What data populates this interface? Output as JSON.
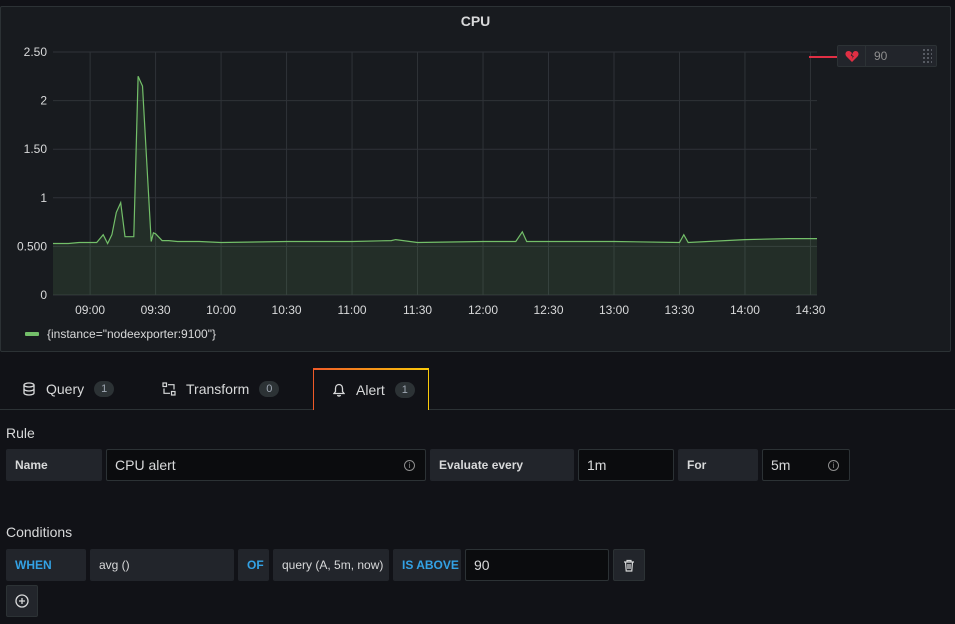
{
  "panel": {
    "title": "CPU",
    "threshold": {
      "value": "90",
      "icon": "heart-broken-icon",
      "color": "#e02f44"
    }
  },
  "chart_data": {
    "type": "area",
    "title": "CPU",
    "y_ticks": [
      "2.50",
      "2",
      "1.50",
      "1",
      "0.500",
      "0"
    ],
    "y_range": [
      0,
      2.5
    ],
    "x_ticks": [
      "09:00",
      "09:30",
      "10:00",
      "10:30",
      "11:00",
      "11:30",
      "12:00",
      "12:30",
      "13:00",
      "13:30",
      "14:00",
      "14:30"
    ],
    "grid": true,
    "legend_placement": "bottom-left",
    "series": [
      {
        "name": "{instance=\"nodeexporter:9100\"}",
        "color": "#73bf69",
        "x": [
          "08:43",
          "08:50",
          "08:55",
          "09:00",
          "09:03",
          "09:06",
          "09:08",
          "09:10",
          "09:12",
          "09:14",
          "09:16",
          "09:18",
          "09:20",
          "09:22",
          "09:23",
          "09:24",
          "09:28",
          "09:29",
          "09:30",
          "09:33",
          "09:36",
          "09:40",
          "09:50",
          "10:00",
          "10:30",
          "11:00",
          "11:18",
          "11:20",
          "11:30",
          "12:00",
          "12:15",
          "12:18",
          "12:20",
          "12:30",
          "13:00",
          "13:30",
          "13:32",
          "13:34",
          "14:00",
          "14:20",
          "14:30",
          "14:33"
        ],
        "values": [
          0.53,
          0.53,
          0.54,
          0.54,
          0.54,
          0.62,
          0.53,
          0.62,
          0.85,
          0.95,
          0.6,
          0.6,
          0.6,
          2.25,
          2.2,
          2.15,
          0.55,
          0.64,
          0.63,
          0.56,
          0.56,
          0.55,
          0.55,
          0.54,
          0.55,
          0.55,
          0.56,
          0.57,
          0.54,
          0.55,
          0.55,
          0.65,
          0.55,
          0.55,
          0.55,
          0.54,
          0.62,
          0.54,
          0.57,
          0.58,
          0.58,
          0.58
        ]
      }
    ],
    "threshold_value": 90
  },
  "tabs": [
    {
      "label": "Query",
      "count": "1",
      "icon": "database-icon"
    },
    {
      "label": "Transform",
      "count": "0",
      "icon": "transform-icon"
    },
    {
      "label": "Alert",
      "count": "1",
      "icon": "bell-icon",
      "active": true
    }
  ],
  "rule": {
    "heading": "Rule",
    "name_label": "Name",
    "name_value": "CPU alert",
    "evaluate_label": "Evaluate every",
    "evaluate_value": "1m",
    "for_label": "For",
    "for_value": "5m"
  },
  "conditions": {
    "heading": "Conditions",
    "when": "WHEN",
    "reducer": "avg ()",
    "of": "OF",
    "query": "query (A, 5m, now)",
    "evaluator": "IS ABOVE",
    "value": "90"
  }
}
